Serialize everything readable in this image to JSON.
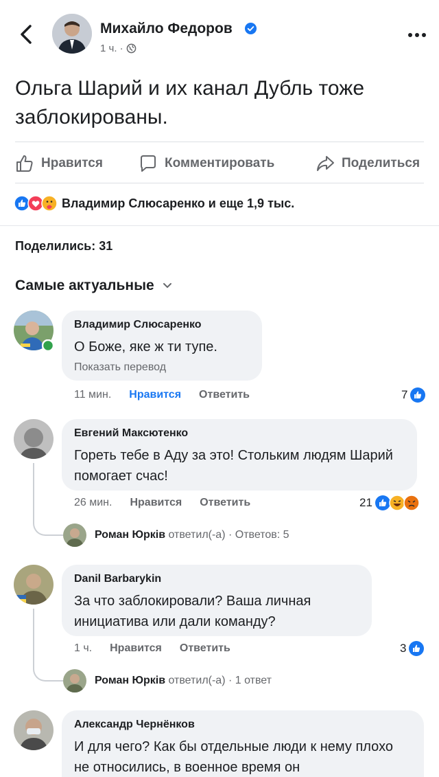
{
  "header": {
    "author": "Михайло Федоров",
    "time": "1 ч. ·",
    "verified_color": "#1877f2"
  },
  "post": {
    "text": "Ольга Шарий и их канал Дубль тоже заблокированы."
  },
  "actions": {
    "like": "Нравится",
    "comment": "Комментировать",
    "share": "Поделиться"
  },
  "reactions": {
    "summary": "Владимир Слюсаренко и еще 1,9 тыс.",
    "icons": [
      "like",
      "love",
      "care"
    ]
  },
  "shares": "Поделились: 31",
  "sort": "Самые актуальные",
  "comments": [
    {
      "name": "Владимир Слюсаренко",
      "text": "О Боже, яке ж ти тупе.",
      "translate": "Показать перевод",
      "time": "11 мин.",
      "like": "Нравится",
      "reply": "Ответить",
      "count": "7",
      "liked": true
    },
    {
      "name": "Евгений Максютенко",
      "text": "Гореть тебе в Аду за это! Стольким людям Шарий помогает счас!",
      "time": "26 мин.",
      "like": "Нравится",
      "reply": "Ответить",
      "count": "21",
      "reply_thread": {
        "name": "Роман Юрків",
        "rest": "ответил(-а) · Ответов: 5"
      }
    },
    {
      "name": "Danil Barbarykin",
      "text": "За что заблокировали? Ваша личная инициатива или дали команду?",
      "time": "1 ч.",
      "like": "Нравится",
      "reply": "Ответить",
      "count": "3",
      "reply_thread": {
        "name": "Роман Юрків",
        "rest": "ответил(-а) · 1 ответ"
      }
    },
    {
      "name": "Александр Чернёнков",
      "text": "И для чего? Как бы отдельные люди к нему плохо не относились, в военное время он"
    }
  ],
  "colors": {
    "accent": "#1877f2",
    "bubble": "#f0f2f5",
    "muted": "#65676b"
  }
}
